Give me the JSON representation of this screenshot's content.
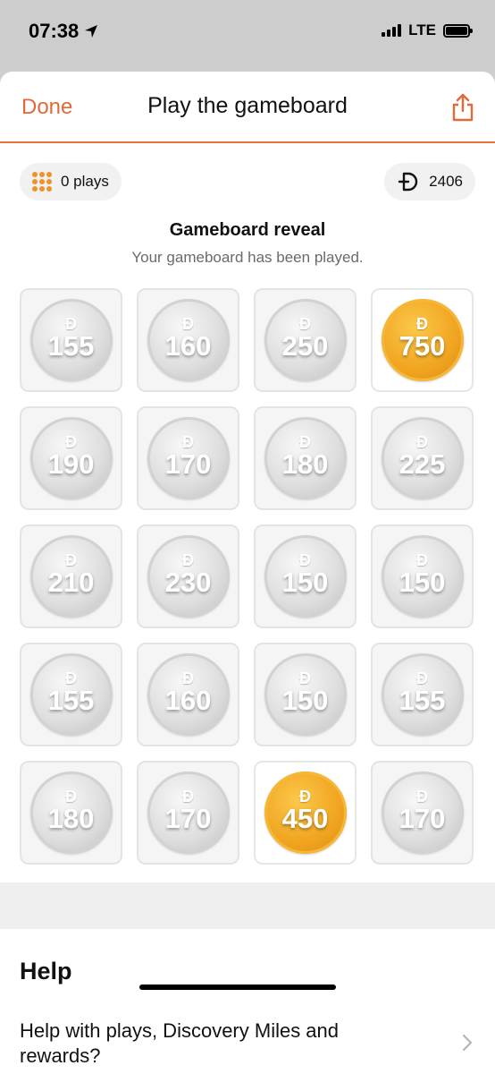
{
  "status_bar": {
    "time": "07:38",
    "network": "LTE"
  },
  "header": {
    "done_label": "Done",
    "title": "Play the gameboard"
  },
  "summary": {
    "plays_label": "0 plays",
    "miles_balance": "2406"
  },
  "reveal": {
    "title": "Gameboard reveal",
    "subtitle": "Your gameboard has been played."
  },
  "coin_symbol": "Đ",
  "tiles": [
    {
      "value": "155",
      "color": "silver"
    },
    {
      "value": "160",
      "color": "silver"
    },
    {
      "value": "250",
      "color": "silver"
    },
    {
      "value": "750",
      "color": "gold"
    },
    {
      "value": "190",
      "color": "silver"
    },
    {
      "value": "170",
      "color": "silver"
    },
    {
      "value": "180",
      "color": "silver"
    },
    {
      "value": "225",
      "color": "silver"
    },
    {
      "value": "210",
      "color": "silver"
    },
    {
      "value": "230",
      "color": "silver"
    },
    {
      "value": "150",
      "color": "silver"
    },
    {
      "value": "150",
      "color": "silver"
    },
    {
      "value": "155",
      "color": "silver"
    },
    {
      "value": "160",
      "color": "silver"
    },
    {
      "value": "150",
      "color": "silver"
    },
    {
      "value": "155",
      "color": "silver"
    },
    {
      "value": "180",
      "color": "silver"
    },
    {
      "value": "170",
      "color": "silver"
    },
    {
      "value": "450",
      "color": "gold"
    },
    {
      "value": "170",
      "color": "silver"
    }
  ],
  "help": {
    "title": "Help",
    "link_label": "Help with plays, Discovery Miles and rewards?"
  },
  "colors": {
    "accent": "#e06a3a",
    "gold": "#f0a31f",
    "silver": "#dedede"
  }
}
